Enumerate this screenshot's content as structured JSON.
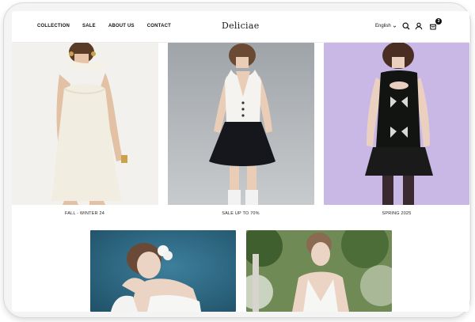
{
  "header": {
    "nav": [
      "COLLECTION",
      "SALE",
      "ABOUT US",
      "CONTACT"
    ],
    "logo": "Deliciae",
    "language": "English",
    "cart_count": "3",
    "icons": [
      "chevron-down-icon",
      "search-icon",
      "user-icon",
      "shopping-bag-icon"
    ]
  },
  "collections": [
    {
      "caption": "FALL - WINTER 24"
    },
    {
      "caption": "SALE UP TO 70%"
    },
    {
      "caption": "SPRING 2025"
    }
  ],
  "colors": {
    "frame": "#f4f4f4",
    "photo_bg_1": "#f2f1ee",
    "photo_bg_2": "#b8bcc0",
    "photo_bg_3": "#c9b8e6",
    "photo_bg_4": "#2f6a86",
    "photo_bg_5": "#5d7b46"
  }
}
